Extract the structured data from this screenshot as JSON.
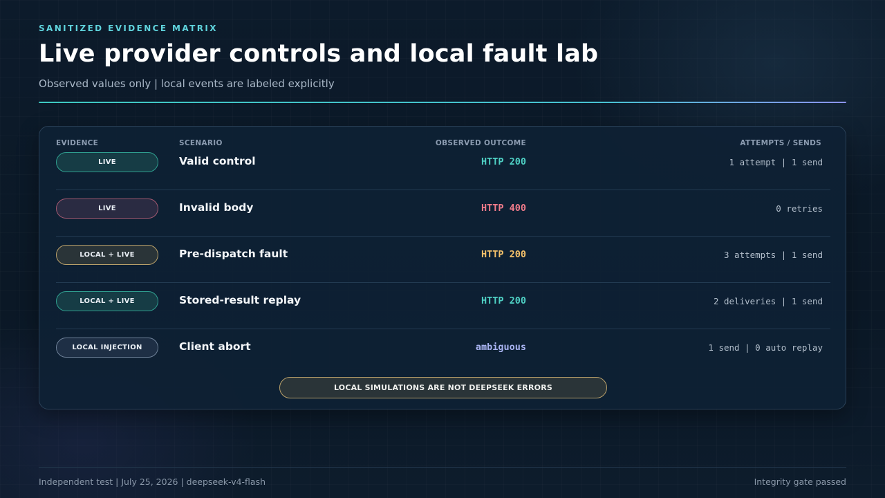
{
  "header": {
    "eyebrow": "SANITIZED EVIDENCE MATRIX",
    "title": "Live provider controls and local fault lab",
    "subtitle": "Observed values only | local events are labeled explicitly"
  },
  "table": {
    "columns": {
      "evidence": "EVIDENCE",
      "scenario": "SCENARIO",
      "outcome": "OBSERVED OUTCOME",
      "attempts": "ATTEMPTS / SENDS"
    },
    "rows": [
      {
        "evidence": "LIVE",
        "scenario": "Valid control",
        "outcome": "HTTP 200",
        "attempts": "1 attempt | 1 send",
        "badge_border": "#2f9e8f",
        "badge_bg": "#163c45",
        "outcome_color": "#4fd1c5"
      },
      {
        "evidence": "LIVE",
        "scenario": "Invalid body",
        "outcome": "HTTP 400",
        "attempts": "0 retries",
        "badge_border": "#a05870",
        "badge_bg": "#2a2b42",
        "outcome_color": "#f07b8a"
      },
      {
        "evidence": "LOCAL + LIVE",
        "scenario": "Pre-dispatch fault",
        "outcome": "HTTP 200",
        "attempts": "3 attempts | 1 send",
        "badge_border": "#b9a06a",
        "badge_bg": "#2a3438",
        "outcome_color": "#f5c26b"
      },
      {
        "evidence": "LOCAL + LIVE",
        "scenario": "Stored-result replay",
        "outcome": "HTTP 200",
        "attempts": "2 deliveries | 1 send",
        "badge_border": "#2f9e8f",
        "badge_bg": "#163c45",
        "outcome_color": "#4fd1c5"
      },
      {
        "evidence": "LOCAL INJECTION",
        "scenario": "Client abort",
        "outcome": "ambiguous",
        "attempts": "1 send | 0 auto replay",
        "badge_border": "#6f8299",
        "badge_bg": "#1e2f45",
        "outcome_color": "#a9b4f2"
      }
    ],
    "note": "LOCAL SIMULATIONS ARE NOT DEEPSEEK ERRORS"
  },
  "footer": {
    "left": "Independent test | July 25, 2026 | deepseek-v4-flash",
    "right": "Integrity gate passed"
  }
}
